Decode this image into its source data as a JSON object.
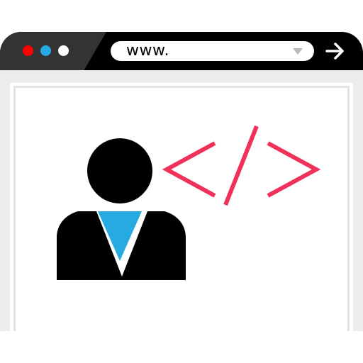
{
  "browser": {
    "window_controls": [
      {
        "name": "close",
        "color": "#ff0000"
      },
      {
        "name": "minimize",
        "color": "#27aae1"
      },
      {
        "name": "maximize",
        "color": "#ffffff"
      }
    ],
    "address_bar": {
      "text": "www.",
      "dropdown_icon": "chevron-down-icon"
    },
    "go_button_icon": "arrow-right-icon"
  },
  "content": {
    "user_icon": "user-avatar-icon",
    "code_icon": "code-tag-icon",
    "colors": {
      "person": "#000000",
      "tie": "#27aae1",
      "code_tag": "#f0325a"
    }
  }
}
